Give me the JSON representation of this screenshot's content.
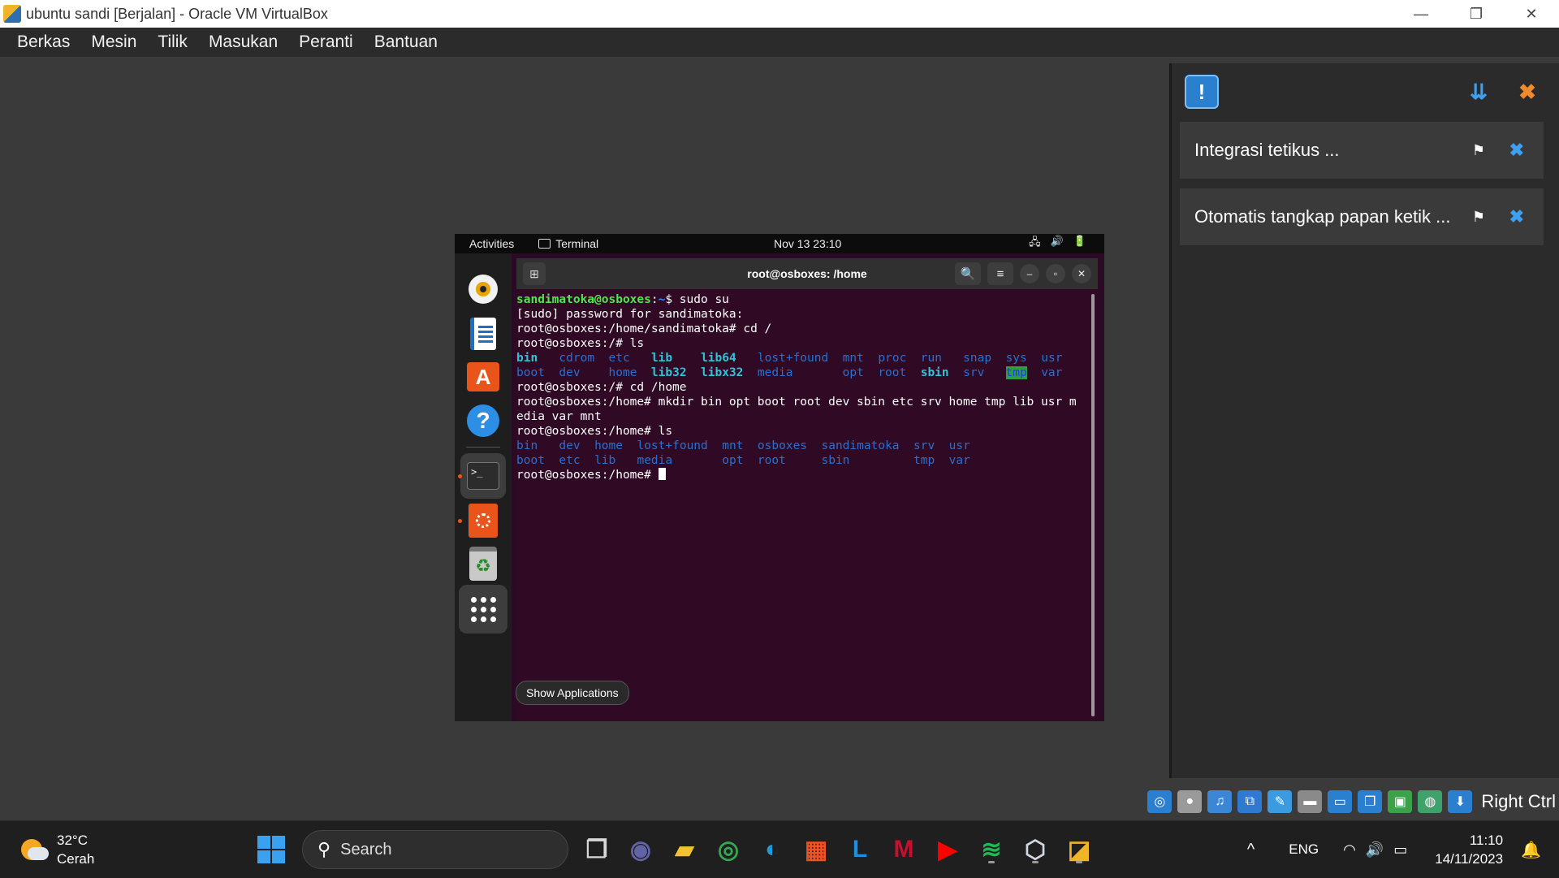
{
  "window": {
    "title": "ubuntu sandi [Berjalan] - Oracle VM VirtualBox",
    "minimize": "—",
    "restore": "❐",
    "close": "✕"
  },
  "menu": [
    "Berkas",
    "Mesin",
    "Tilik",
    "Masukan",
    "Peranti",
    "Bantuan"
  ],
  "guest": {
    "topbar": {
      "activities": "Activities",
      "app": "Terminal",
      "clock": "Nov 13  23:10",
      "tray": [
        "🖧",
        "🔊",
        "🔋"
      ]
    },
    "dock": {
      "terminal_glyph": ">_",
      "software_glyph": "A",
      "help_glyph": "?",
      "trash_glyph": "♻",
      "show_apps_tooltip": "Show Applications"
    },
    "terminal": {
      "title": "root@osboxes: /home",
      "newtab_glyph": "⊞",
      "search_glyph": "🔍",
      "menu_glyph": "≡",
      "min_glyph": "–",
      "max_glyph": "▫",
      "close_glyph": "✕",
      "lines": [
        [
          {
            "t": "sandimatoka@osboxes",
            "c": "c-green"
          },
          {
            "t": ":",
            "c": ""
          },
          {
            "t": "~",
            "c": "c-bold"
          },
          {
            "t": "$ sudo su",
            "c": ""
          }
        ],
        [
          {
            "t": "[sudo] password for sandimatoka:",
            "c": ""
          }
        ],
        [
          {
            "t": "root@osboxes:/home/sandimatoka# cd /",
            "c": ""
          }
        ],
        [
          {
            "t": "root@osboxes:/# ls",
            "c": ""
          }
        ],
        [
          {
            "t": "bin",
            "c": "c-cyan"
          },
          {
            "t": "   ",
            "c": ""
          },
          {
            "t": "cdrom",
            "c": "c-dirblue"
          },
          {
            "t": "  ",
            "c": ""
          },
          {
            "t": "etc",
            "c": "c-dirblue"
          },
          {
            "t": "   ",
            "c": ""
          },
          {
            "t": "lib",
            "c": "c-cyan"
          },
          {
            "t": "    ",
            "c": ""
          },
          {
            "t": "lib64",
            "c": "c-cyan"
          },
          {
            "t": "   ",
            "c": ""
          },
          {
            "t": "lost+found",
            "c": "c-dirblue"
          },
          {
            "t": "  ",
            "c": ""
          },
          {
            "t": "mnt",
            "c": "c-dirblue"
          },
          {
            "t": "  ",
            "c": ""
          },
          {
            "t": "proc",
            "c": "c-dirblue"
          },
          {
            "t": "  ",
            "c": ""
          },
          {
            "t": "run",
            "c": "c-dirblue"
          },
          {
            "t": "   ",
            "c": ""
          },
          {
            "t": "snap",
            "c": "c-dirblue"
          },
          {
            "t": "  ",
            "c": ""
          },
          {
            "t": "sys",
            "c": "c-dirblue"
          },
          {
            "t": "  ",
            "c": ""
          },
          {
            "t": "usr",
            "c": "c-dirblue"
          }
        ],
        [
          {
            "t": "boot",
            "c": "c-dirblue"
          },
          {
            "t": "  ",
            "c": ""
          },
          {
            "t": "dev",
            "c": "c-dirblue"
          },
          {
            "t": "    ",
            "c": ""
          },
          {
            "t": "home",
            "c": "c-dirblue"
          },
          {
            "t": "  ",
            "c": ""
          },
          {
            "t": "lib32",
            "c": "c-cyan"
          },
          {
            "t": "  ",
            "c": ""
          },
          {
            "t": "libx32",
            "c": "c-cyan"
          },
          {
            "t": "  ",
            "c": ""
          },
          {
            "t": "media",
            "c": "c-dirblue"
          },
          {
            "t": "       ",
            "c": ""
          },
          {
            "t": "opt",
            "c": "c-dirblue"
          },
          {
            "t": "  ",
            "c": ""
          },
          {
            "t": "root",
            "c": "c-dirblue"
          },
          {
            "t": "  ",
            "c": ""
          },
          {
            "t": "sbin",
            "c": "c-cyan"
          },
          {
            "t": "  ",
            "c": ""
          },
          {
            "t": "srv",
            "c": "c-dirblue"
          },
          {
            "t": "   ",
            "c": ""
          },
          {
            "t": "tmp",
            "c": "c-tmp"
          },
          {
            "t": "  ",
            "c": ""
          },
          {
            "t": "var",
            "c": "c-dirblue"
          }
        ],
        [
          {
            "t": "root@osboxes:/# cd /home",
            "c": ""
          }
        ],
        [
          {
            "t": "root@osboxes:/home# mkdir bin opt boot root dev sbin etc srv home tmp lib usr m",
            "c": ""
          }
        ],
        [
          {
            "t": "edia var mnt",
            "c": ""
          }
        ],
        [
          {
            "t": "root@osboxes:/home# ls",
            "c": ""
          }
        ],
        [
          {
            "t": "bin",
            "c": "c-dirblue"
          },
          {
            "t": "   ",
            "c": ""
          },
          {
            "t": "dev",
            "c": "c-dirblue"
          },
          {
            "t": "  ",
            "c": ""
          },
          {
            "t": "home",
            "c": "c-dirblue"
          },
          {
            "t": "  ",
            "c": ""
          },
          {
            "t": "lost+found",
            "c": "c-dirblue"
          },
          {
            "t": "  ",
            "c": ""
          },
          {
            "t": "mnt",
            "c": "c-dirblue"
          },
          {
            "t": "  ",
            "c": ""
          },
          {
            "t": "osboxes",
            "c": "c-dirblue"
          },
          {
            "t": "  ",
            "c": ""
          },
          {
            "t": "sandimatoka",
            "c": "c-dirblue"
          },
          {
            "t": "  ",
            "c": ""
          },
          {
            "t": "srv",
            "c": "c-dirblue"
          },
          {
            "t": "  ",
            "c": ""
          },
          {
            "t": "usr",
            "c": "c-dirblue"
          }
        ],
        [
          {
            "t": "boot",
            "c": "c-dirblue"
          },
          {
            "t": "  ",
            "c": ""
          },
          {
            "t": "etc",
            "c": "c-dirblue"
          },
          {
            "t": "  ",
            "c": ""
          },
          {
            "t": "lib",
            "c": "c-dirblue"
          },
          {
            "t": "   ",
            "c": ""
          },
          {
            "t": "media",
            "c": "c-dirblue"
          },
          {
            "t": "       ",
            "c": ""
          },
          {
            "t": "opt",
            "c": "c-dirblue"
          },
          {
            "t": "  ",
            "c": ""
          },
          {
            "t": "root",
            "c": "c-dirblue"
          },
          {
            "t": "     ",
            "c": ""
          },
          {
            "t": "sbin",
            "c": "c-dirblue"
          },
          {
            "t": "         ",
            "c": ""
          },
          {
            "t": "tmp",
            "c": "c-dirblue"
          },
          {
            "t": "  ",
            "c": ""
          },
          {
            "t": "var",
            "c": "c-dirblue"
          }
        ],
        [
          {
            "t": "root@osboxes:/home# ",
            "c": ""
          },
          {
            "t": "",
            "c": "cursor"
          }
        ]
      ]
    }
  },
  "notifications": {
    "alert_glyph": "!",
    "sort_glyph": "⇊",
    "clear_glyph": "✖",
    "items": [
      {
        "text": "Integrasi tetikus ...",
        "suppress": "⚑",
        "close": "✖"
      },
      {
        "text": "Otomatis tangkap papan ketik ...",
        "suppress": "⚑",
        "close": "✖"
      }
    ]
  },
  "vbox_status": {
    "icons": [
      {
        "name": "hard-disk-icon",
        "glyph": "◎",
        "color": "#2a7fcf"
      },
      {
        "name": "optical-drive-icon",
        "glyph": "●",
        "color": "#9a9a9a"
      },
      {
        "name": "audio-icon",
        "glyph": "♫",
        "color": "#3b87d6"
      },
      {
        "name": "network-icon",
        "glyph": "⧉",
        "color": "#2d7ad0"
      },
      {
        "name": "usb-icon",
        "glyph": "✎",
        "color": "#3b9ae0"
      },
      {
        "name": "shared-folder-icon",
        "glyph": "▬",
        "color": "#8a8a8a"
      },
      {
        "name": "display-icon",
        "glyph": "▭",
        "color": "#2a7fcf"
      },
      {
        "name": "video-capture-icon",
        "glyph": "❐",
        "color": "#2a7fcf"
      },
      {
        "name": "cpu-icon",
        "glyph": "▣",
        "color": "#3ba24a"
      },
      {
        "name": "guest-additions-icon",
        "glyph": "◍",
        "color": "#3fa26a"
      },
      {
        "name": "mouse-integration-icon",
        "glyph": "⬇",
        "color": "#2a7fcf"
      }
    ],
    "host_key": "Right Ctrl"
  },
  "taskbar": {
    "weather_temp": "32°C",
    "weather_desc": "Cerah",
    "search_placeholder": "Search",
    "apps": [
      {
        "name": "task-view-icon",
        "glyph": "❐",
        "color": "#d8d8d8"
      },
      {
        "name": "teams-icon",
        "glyph": "◉",
        "color": "#6264a7"
      },
      {
        "name": "file-explorer-icon",
        "glyph": "▰",
        "color": "#f2c230"
      },
      {
        "name": "chrome-icon",
        "glyph": "◎",
        "color": "#34a853"
      },
      {
        "name": "edge-icon",
        "glyph": "◐",
        "color": "#1f9ad8"
      },
      {
        "name": "store-icon",
        "glyph": "▦",
        "color": "#f25022"
      },
      {
        "name": "l-app-icon",
        "glyph": "L",
        "color": "#1e8fe0"
      },
      {
        "name": "mcafee-icon",
        "glyph": "M",
        "color": "#c8102e"
      },
      {
        "name": "youtube-icon",
        "glyph": "▶",
        "color": "#ff0000"
      },
      {
        "name": "spotify-icon",
        "glyph": "≋",
        "color": "#1db954"
      },
      {
        "name": "virtualbox-manager-icon",
        "glyph": "⬡",
        "color": "#cfd8e3"
      },
      {
        "name": "virtualbox-vm-icon",
        "glyph": "◪",
        "color": "#f0b429"
      }
    ],
    "tray": {
      "chevron": "^",
      "lang": "ENG",
      "wifi": "◠",
      "volume": "🔊",
      "battery": "▭",
      "time": "11:10",
      "date": "14/11/2023",
      "bell": "🔔"
    }
  }
}
